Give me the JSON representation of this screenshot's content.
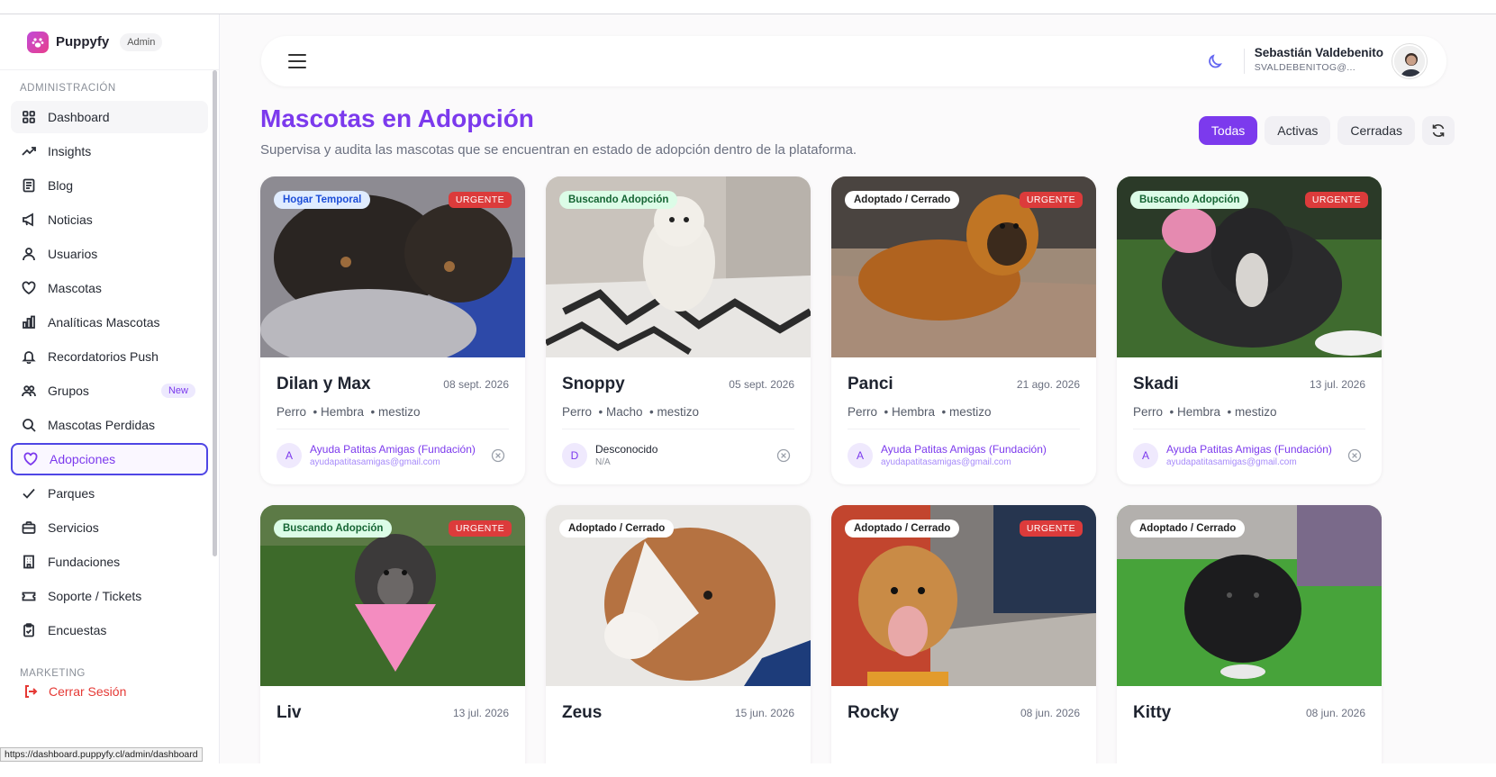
{
  "brand": {
    "name": "Puppyfy",
    "badge": "Admin"
  },
  "sidebar": {
    "section_admin": "ADMINISTRACIÓN",
    "section_marketing": "MARKETING",
    "items": [
      {
        "label": "Dashboard",
        "icon": "grid-icon"
      },
      {
        "label": "Insights",
        "icon": "trend-icon"
      },
      {
        "label": "Blog",
        "icon": "document-icon"
      },
      {
        "label": "Noticias",
        "icon": "megaphone-icon"
      },
      {
        "label": "Usuarios",
        "icon": "users-icon"
      },
      {
        "label": "Mascotas",
        "icon": "heart-icon"
      },
      {
        "label": "Analíticas Mascotas",
        "icon": "bar-chart-icon"
      },
      {
        "label": "Recordatorios Push",
        "icon": "bell-icon"
      },
      {
        "label": "Grupos",
        "icon": "group-icon",
        "badge": "New"
      },
      {
        "label": "Mascotas Perdidas",
        "icon": "search-icon"
      },
      {
        "label": "Adopciones",
        "icon": "heart-icon"
      },
      {
        "label": "Parques",
        "icon": "check-icon"
      },
      {
        "label": "Servicios",
        "icon": "briefcase-icon"
      },
      {
        "label": "Fundaciones",
        "icon": "building-icon"
      },
      {
        "label": "Soporte / Tickets",
        "icon": "ticket-icon"
      },
      {
        "label": "Encuestas",
        "icon": "clipboard-icon"
      }
    ],
    "logout": "Cerrar Sesión"
  },
  "status_url": "https://dashboard.puppyfy.cl/admin/dashboard",
  "header": {
    "user_name": "Sebastián Valdebenito",
    "user_email": "SVALDEBENITOG@..."
  },
  "page": {
    "title": "Mascotas en Adopción",
    "subtitle": "Supervisa y audita las mascotas que se encuentran en estado de adopción dentro de la plataforma.",
    "filters": [
      "Todas",
      "Activas",
      "Cerradas"
    ],
    "active_filter": "Todas"
  },
  "colors": {
    "accent": "#7c3aed",
    "urgent": "#dc3b3b"
  },
  "cards": [
    {
      "status": "Hogar Temporal",
      "urgent": "URGENTE",
      "name": "Dilan y Max",
      "date": "08 sept. 2026",
      "species": "Perro",
      "sex": "Hembra",
      "breed": "mestizo",
      "org_initial": "A",
      "org": "Ayuda Patitas Amigas (Fundación)",
      "org_mail": "ayudapatitasamigas@gmail.com"
    },
    {
      "status": "Buscando Adopción",
      "urgent": "",
      "name": "Snoppy",
      "date": "05 sept. 2026",
      "species": "Perro",
      "sex": "Macho",
      "breed": "mestizo",
      "org_initial": "D",
      "org": "Desconocido",
      "org_mail": "N/A"
    },
    {
      "status": "Adoptado / Cerrado",
      "urgent": "URGENTE",
      "name": "Panci",
      "date": "21 ago. 2026",
      "species": "Perro",
      "sex": "Hembra",
      "breed": "mestizo",
      "org_initial": "A",
      "org": "Ayuda Patitas Amigas (Fundación)",
      "org_mail": "ayudapatitasamigas@gmail.com"
    },
    {
      "status": "Buscando Adopción",
      "urgent": "URGENTE",
      "name": "Skadi",
      "date": "13 jul. 2026",
      "species": "Perro",
      "sex": "Hembra",
      "breed": "mestizo",
      "org_initial": "A",
      "org": "Ayuda Patitas Amigas (Fundación)",
      "org_mail": "ayudapatitasamigas@gmail.com"
    },
    {
      "status": "Buscando Adopción",
      "urgent": "URGENTE",
      "name": "Liv",
      "date": "13 jul. 2026"
    },
    {
      "status": "Adoptado / Cerrado",
      "urgent": "",
      "name": "Zeus",
      "date": "15 jun. 2026"
    },
    {
      "status": "Adoptado / Cerrado",
      "urgent": "URGENTE",
      "name": "Rocky",
      "date": "08 jun. 2026"
    },
    {
      "status": "Adoptado / Cerrado",
      "urgent": "",
      "name": "Kitty",
      "date": "08 jun. 2026"
    }
  ]
}
